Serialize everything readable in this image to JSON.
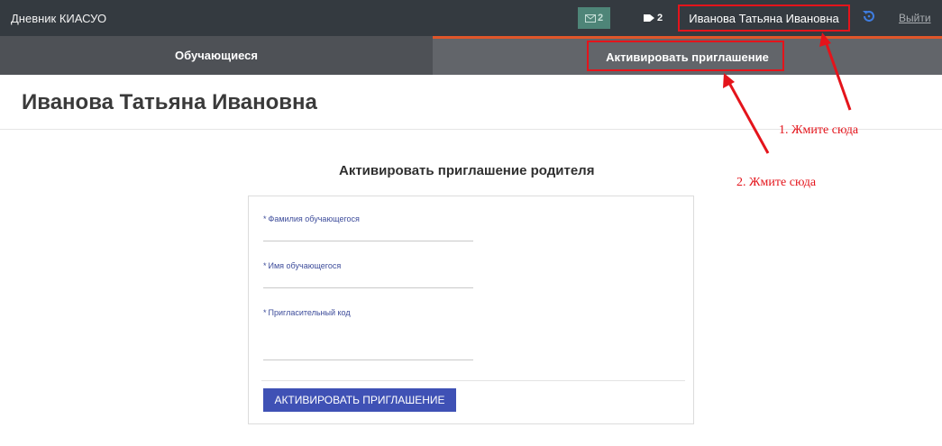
{
  "header": {
    "brand": "Дневник КИАСУО",
    "messages_count": "2",
    "notifications_count": "2",
    "user_name": "Иванова Татьяна Ивановна",
    "logout_label": "Выйти"
  },
  "nav": {
    "tabs": [
      {
        "label": "Обучающиеся",
        "active": false
      },
      {
        "label": "Активировать приглашение",
        "active": true
      }
    ]
  },
  "page": {
    "title": "Иванова Татьяна Ивановна",
    "form_title": "Активировать приглашение родителя"
  },
  "form": {
    "required_mark": "*",
    "fields": [
      {
        "label": "Фамилия обучающегося",
        "value": ""
      },
      {
        "label": "Имя обучающегося",
        "value": ""
      },
      {
        "label": "Пригласительный код",
        "value": ""
      }
    ],
    "submit_label": "АКТИВИРОВАТЬ ПРИГЛАШЕНИЕ"
  },
  "annotations": {
    "step1": "1. Жмите сюда",
    "step2": "2. Жмите сюда"
  },
  "colors": {
    "topbar": "#343a40",
    "nav": "#56595e",
    "active_tab_accent": "#e0562a",
    "highlight": "#e4141b",
    "submit_button": "#3f51b5",
    "label_text": "#3e4d9b"
  }
}
